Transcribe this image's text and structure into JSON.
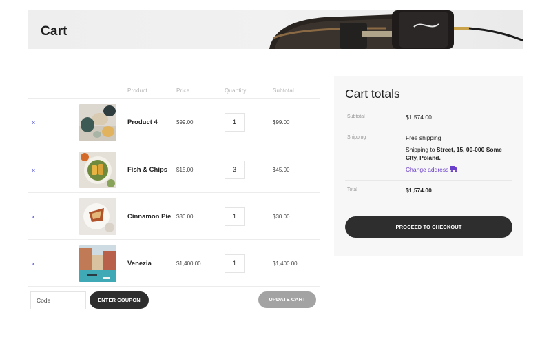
{
  "page": {
    "title": "Cart"
  },
  "cart": {
    "headers": {
      "product": "Product",
      "price": "Price",
      "quantity": "Quantity",
      "subtotal": "Subtotal"
    },
    "items": [
      {
        "remove": "×",
        "image_icon": "pumpkins-image",
        "name": "Product 4",
        "price": "$99.00",
        "quantity": "1",
        "subtotal": "$99.00"
      },
      {
        "remove": "×",
        "image_icon": "fish-chips-image",
        "name": "Fish & Chips",
        "price": "$15.00",
        "quantity": "3",
        "subtotal": "$45.00"
      },
      {
        "remove": "×",
        "image_icon": "cinnamon-pie-image",
        "name": "Cinnamon Pie",
        "price": "$30.00",
        "quantity": "1",
        "subtotal": "$30.00"
      },
      {
        "remove": "×",
        "image_icon": "venezia-image",
        "name": "Venezia",
        "price": "$1,400.00",
        "quantity": "1",
        "subtotal": "$1,400.00"
      }
    ],
    "coupon_placeholder": "Code",
    "enter_coupon_label": "ENTER COUPON",
    "update_cart_label": "UPDATE CART"
  },
  "totals": {
    "title": "Cart totals",
    "subtotal_label": "Subtotal",
    "subtotal_value": "$1,574.00",
    "shipping_label": "Shipping",
    "shipping_method": "Free shipping",
    "shipping_to_prefix": "Shipping to ",
    "shipping_address_line1": "Street, 15, 00-000 Some",
    "shipping_address_line2": "CIty, Poland.",
    "change_address_label": "Change address",
    "total_label": "Total",
    "total_value": "$1,574.00",
    "checkout_label": "PROCEED TO CHECKOUT"
  },
  "colors": {
    "dark_button": "#2e2e2e",
    "link_purple": "#6a3fc9",
    "remove_blue": "#3a3ad8"
  }
}
